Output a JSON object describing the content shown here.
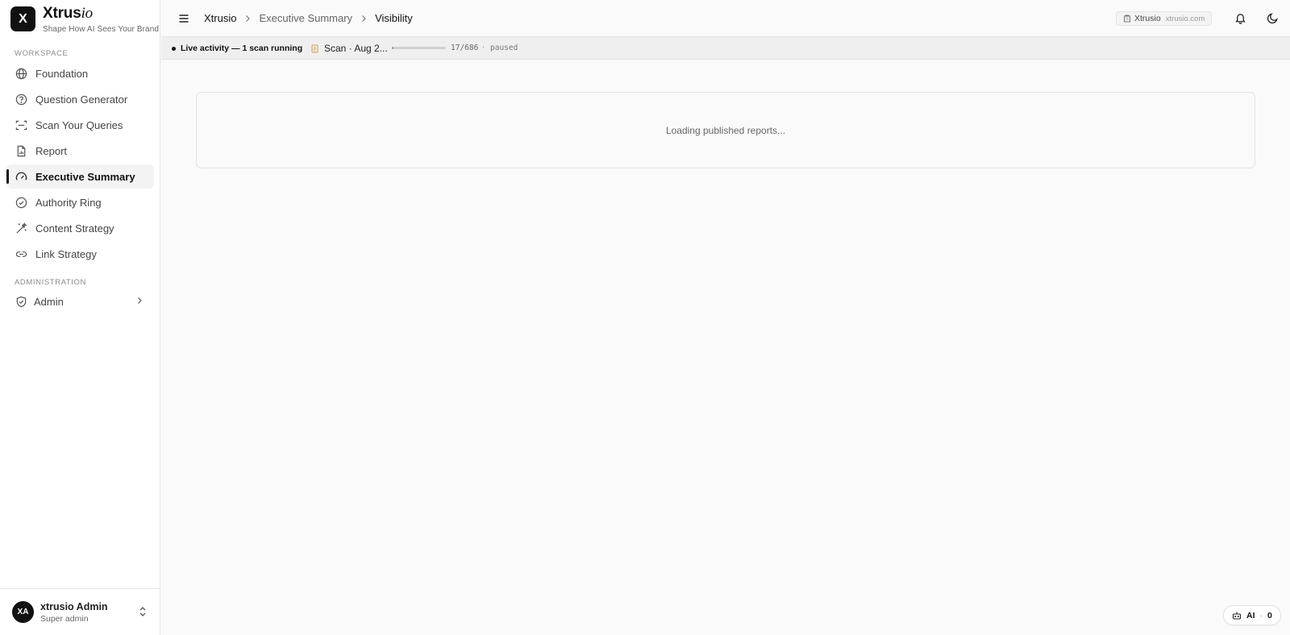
{
  "brand": {
    "logo_letter": "X",
    "name_main": "Xtrus",
    "name_accent": "io",
    "tagline": "Shape How AI Sees Your Brand"
  },
  "sidebar": {
    "workspace_label": "WORKSPACE",
    "items": [
      {
        "label": "Foundation",
        "icon": "globe-icon"
      },
      {
        "label": "Question Generator",
        "icon": "question-circle-icon"
      },
      {
        "label": "Scan Your Queries",
        "icon": "scan-icon"
      },
      {
        "label": "Report",
        "icon": "file-chart-icon"
      },
      {
        "label": "Executive Summary",
        "icon": "gauge-icon",
        "active": true
      },
      {
        "label": "Authority Ring",
        "icon": "check-circle-icon"
      },
      {
        "label": "Content Strategy",
        "icon": "magic-wand-icon"
      },
      {
        "label": "Link Strategy",
        "icon": "link-icon"
      }
    ],
    "admin_label": "ADMINISTRATION",
    "admin_item": {
      "label": "Admin",
      "icon": "shield-check-icon"
    }
  },
  "user": {
    "initials": "XA",
    "name": "xtrusio Admin",
    "role": "Super admin"
  },
  "header": {
    "breadcrumb": [
      "Xtrusio",
      "Executive Summary",
      "Visibility"
    ],
    "site_name": "Xtrusio",
    "site_domain": "xtrusio.com"
  },
  "activity": {
    "live_text": "Live activity — 1 scan running",
    "scan_label": "Scan · Aug 2...",
    "progress": 0.025,
    "count": "17/686",
    "separator": "·",
    "status": "paused"
  },
  "main": {
    "loading_text": "Loading published reports..."
  },
  "ai_badge": {
    "label": "AI",
    "separator": "·",
    "count": "0"
  }
}
